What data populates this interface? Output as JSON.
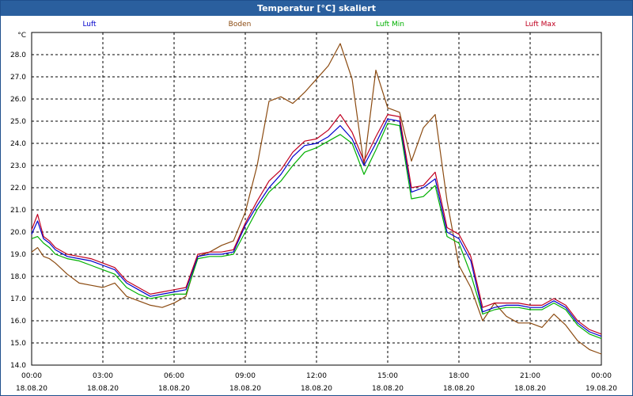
{
  "window": {
    "title": "Temperatur [°C] skaliert"
  },
  "colors": {
    "Luft": "#0000cc",
    "Boden": "#8b4a10",
    "Luft Min": "#00b000",
    "Luft Max": "#c00020"
  },
  "chart_data": {
    "type": "line",
    "title": "Temperatur [°C] skaliert",
    "ylabel": "°C",
    "xlabel": "",
    "ylim": [
      14.0,
      29.0
    ],
    "yticks": [
      "14.0",
      "15.0",
      "16.0",
      "17.0",
      "18.0",
      "19.0",
      "20.0",
      "21.0",
      "22.0",
      "23.0",
      "24.0",
      "25.0",
      "26.0",
      "27.0",
      "28.0"
    ],
    "xlim": [
      "18.08.20 00:00",
      "19.08.20 00:00"
    ],
    "xticks": [
      {
        "time": "00:00",
        "date": "18.08.20"
      },
      {
        "time": "03:00",
        "date": "18.08.20"
      },
      {
        "time": "06:00",
        "date": "18.08.20"
      },
      {
        "time": "09:00",
        "date": "18.08.20"
      },
      {
        "time": "12:00",
        "date": "18.08.20"
      },
      {
        "time": "15:00",
        "date": "18.08.20"
      },
      {
        "time": "18:00",
        "date": "18.08.20"
      },
      {
        "time": "21:00",
        "date": "18.08.20"
      },
      {
        "time": "00:00",
        "date": "19.08.20"
      }
    ],
    "grid": true,
    "legend": "top",
    "x_hours": [
      0,
      0.25,
      0.5,
      0.75,
      1,
      1.5,
      2,
      2.5,
      3,
      3.5,
      4,
      4.5,
      5,
      5.5,
      6,
      6.5,
      7,
      7.5,
      8,
      8.5,
      9,
      9.5,
      10,
      10.5,
      11,
      11.5,
      12,
      12.5,
      13,
      13.5,
      14,
      14.5,
      15,
      15.5,
      16,
      16.5,
      17,
      17.5,
      18,
      18.5,
      19,
      19.5,
      20,
      20.5,
      21,
      21.5,
      22,
      22.5,
      23,
      23.5,
      24
    ],
    "series": [
      {
        "name": "Luft",
        "values": [
          19.9,
          20.5,
          19.7,
          19.5,
          19.2,
          18.9,
          18.8,
          18.7,
          18.5,
          18.3,
          17.7,
          17.4,
          17.1,
          17.2,
          17.3,
          17.4,
          18.9,
          19.0,
          19.0,
          19.1,
          20.3,
          21.2,
          22.0,
          22.6,
          23.4,
          23.9,
          24.0,
          24.3,
          24.8,
          24.2,
          23.0,
          24.0,
          25.1,
          25.0,
          21.8,
          22.0,
          22.4,
          20.0,
          19.7,
          18.7,
          16.4,
          16.6,
          16.7,
          16.7,
          16.6,
          16.6,
          16.9,
          16.6,
          15.9,
          15.5,
          15.3
        ]
      },
      {
        "name": "Boden",
        "values": [
          19.1,
          19.3,
          18.9,
          18.8,
          18.6,
          18.1,
          17.7,
          17.6,
          17.5,
          17.7,
          17.1,
          16.9,
          16.7,
          16.6,
          16.8,
          17.1,
          18.9,
          19.1,
          19.4,
          19.6,
          20.9,
          23.0,
          25.9,
          26.1,
          25.8,
          26.3,
          26.9,
          27.5,
          28.5,
          26.9,
          23.0,
          27.3,
          25.6,
          25.4,
          23.2,
          24.7,
          25.3,
          21.4,
          18.5,
          17.5,
          16.0,
          16.8,
          16.2,
          15.9,
          15.9,
          15.7,
          16.3,
          15.8,
          15.1,
          14.7,
          14.5
        ]
      },
      {
        "name": "Luft Min",
        "values": [
          19.7,
          19.8,
          19.5,
          19.3,
          19.0,
          18.8,
          18.7,
          18.5,
          18.3,
          18.1,
          17.5,
          17.2,
          17.0,
          17.1,
          17.2,
          17.2,
          18.8,
          18.9,
          18.9,
          19.0,
          20.0,
          21.0,
          21.8,
          22.3,
          23.0,
          23.6,
          23.8,
          24.1,
          24.4,
          24.0,
          22.6,
          23.7,
          24.9,
          24.8,
          21.5,
          21.6,
          22.1,
          19.8,
          19.5,
          18.1,
          16.3,
          16.5,
          16.6,
          16.6,
          16.5,
          16.5,
          16.8,
          16.5,
          15.8,
          15.4,
          15.2
        ]
      },
      {
        "name": "Luft Max",
        "values": [
          20.1,
          20.8,
          19.8,
          19.6,
          19.3,
          19.0,
          18.9,
          18.8,
          18.6,
          18.4,
          17.8,
          17.5,
          17.2,
          17.3,
          17.4,
          17.5,
          19.0,
          19.1,
          19.1,
          19.2,
          20.4,
          21.4,
          22.3,
          22.8,
          23.6,
          24.1,
          24.2,
          24.6,
          25.3,
          24.5,
          23.2,
          24.3,
          25.3,
          25.2,
          22.0,
          22.1,
          22.7,
          20.2,
          19.9,
          18.9,
          16.6,
          16.8,
          16.8,
          16.8,
          16.7,
          16.7,
          17.0,
          16.7,
          16.0,
          15.6,
          15.4
        ]
      }
    ]
  }
}
